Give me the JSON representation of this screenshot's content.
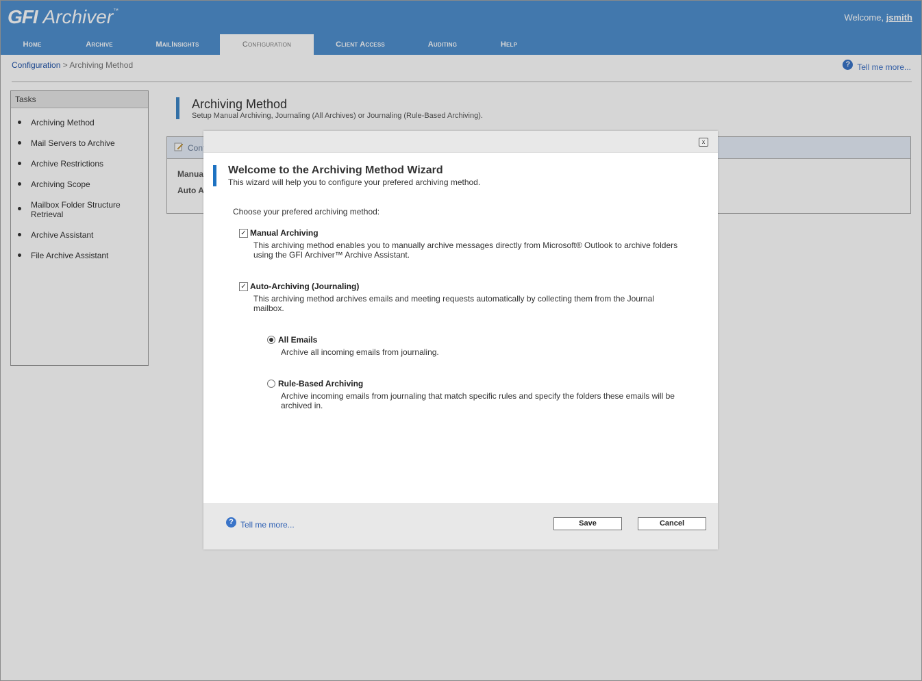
{
  "header": {
    "logo_bold": "GFI",
    "logo_text": "Archiver",
    "logo_tm": "™",
    "welcome_label": "Welcome,",
    "username": "jsmith"
  },
  "nav": {
    "items": [
      {
        "label": "Home"
      },
      {
        "label": "Archive"
      },
      {
        "label": "MailInsights"
      },
      {
        "label": "Configuration",
        "active": true
      },
      {
        "label": "Client Access"
      },
      {
        "label": "Auditing"
      },
      {
        "label": "Help"
      }
    ]
  },
  "breadcrumb": {
    "root": "Configuration",
    "separator": ">",
    "current": "Archiving Method"
  },
  "help": {
    "icon": "?",
    "link": "Tell me more..."
  },
  "tasks": {
    "header": "Tasks",
    "items": [
      {
        "label": "Archiving Method"
      },
      {
        "label": "Mail Servers to Archive"
      },
      {
        "label": "Archive Restrictions"
      },
      {
        "label": "Archiving Scope"
      },
      {
        "label": "Mailbox Folder Structure Retrieval"
      },
      {
        "label": "Archive Assistant"
      },
      {
        "label": "File Archive Assistant"
      }
    ]
  },
  "page": {
    "title": "Archiving Method",
    "subtitle": "Setup Manual Archiving, Journaling (All Archives) or Journaling (Rule-Based Archiving).",
    "config_box": {
      "title": "Conf",
      "row1": "Manua",
      "row2": "Auto A"
    }
  },
  "wizard": {
    "close_icon": "x",
    "title": "Welcome to the Archiving Method Wizard",
    "subtitle": "This wizard will help you to configure your prefered archiving method.",
    "choose_label": "Choose your prefered archiving method:",
    "manual": {
      "label": "Manual Archiving",
      "checked": true,
      "desc1": "This archiving method enables you to manually archive messages directly from Microsoft® Outlook to archive folders",
      "desc2": "using the GFI Archiver™ Archive Assistant."
    },
    "auto": {
      "label": "Auto-Archiving (Journaling)",
      "checked": true,
      "desc1": "This archiving method archives emails and meeting requests automatically by collecting them from the Journal",
      "desc2": "mailbox."
    },
    "all_emails": {
      "label": "All Emails",
      "selected": true,
      "desc": "Archive all incoming emails from journaling."
    },
    "rule_based": {
      "label": "Rule-Based Archiving",
      "selected": false,
      "desc1": "Archive incoming emails from journaling that match specific rules and specify the folders these emails will be",
      "desc2": "archived in."
    },
    "footer": {
      "help_icon": "?",
      "help_link": "Tell me more...",
      "save_label": "Save",
      "cancel_label": "Cancel"
    }
  },
  "colors": {
    "header_bg": "#4f8fcf",
    "accent_bar": "#1d72c2",
    "link": "#2d5fb3"
  }
}
